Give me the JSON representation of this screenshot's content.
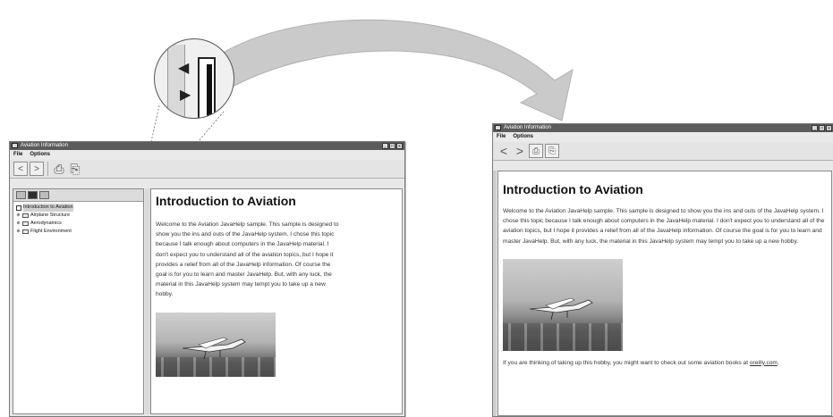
{
  "arrow": {
    "color": "#c8c8c8"
  },
  "left_window": {
    "title": "Aviation Information",
    "window_buttons": [
      "_",
      "□",
      "x"
    ],
    "menu": [
      "File",
      "Options"
    ],
    "toolbar": {
      "back_icon": "back-arrow-icon",
      "forward_icon": "forward-arrow-icon",
      "print_icon": "print-icon",
      "print_setup_icon": "print-setup-icon"
    },
    "nav_tabs": [
      "toc-tab",
      "index-tab",
      "search-tab"
    ],
    "tree": [
      {
        "label": "Introduction to Aviation",
        "type": "doc",
        "selected": true
      },
      {
        "label": "Airplane Structure",
        "type": "folder"
      },
      {
        "label": "Aerodynamics",
        "type": "folder"
      },
      {
        "label": "Flight Environment",
        "type": "folder"
      }
    ],
    "article": {
      "heading": "Introduction to Aviation",
      "body": "Welcome to the Aviation JavaHelp sample. This sample is designed to show you the ins and outs of the JavaHelp system. I chose this topic because I talk enough about computers in the JavaHelp material. I don't expect you to understand all of the aviation topics, but I hope it provides a relief from all of the JavaHelp information. Of course the goal is for you to learn and master JavaHelp. But, with any luck, the material in this JavaHelp system may tempt you to take up a new hobby."
    }
  },
  "right_window": {
    "title": "Aviation Information",
    "window_buttons": [
      "_",
      "□",
      "x"
    ],
    "menu": [
      "File",
      "Options"
    ],
    "article": {
      "heading": "Introduction to Aviation",
      "body": "Welcome to the Aviation JavaHelp sample. This sample is designed to show you the ins and outs of the JavaHelp system. I chose this topic because I talk enough about computers in the JavaHelp material. I don't expect you to understand all of the aviation topics, but I hope it provides a relief from all of the JavaHelp information. Of course the goal is for you to learn and master JavaHelp. But, with any luck, the material in this JavaHelp system may tempt you to take up a new hobby.",
      "footer_text": "If you are thinking of taking up this hobby, you might want to check out some aviation books at ",
      "footer_link": "oreilly.com",
      "footer_end": "."
    }
  }
}
